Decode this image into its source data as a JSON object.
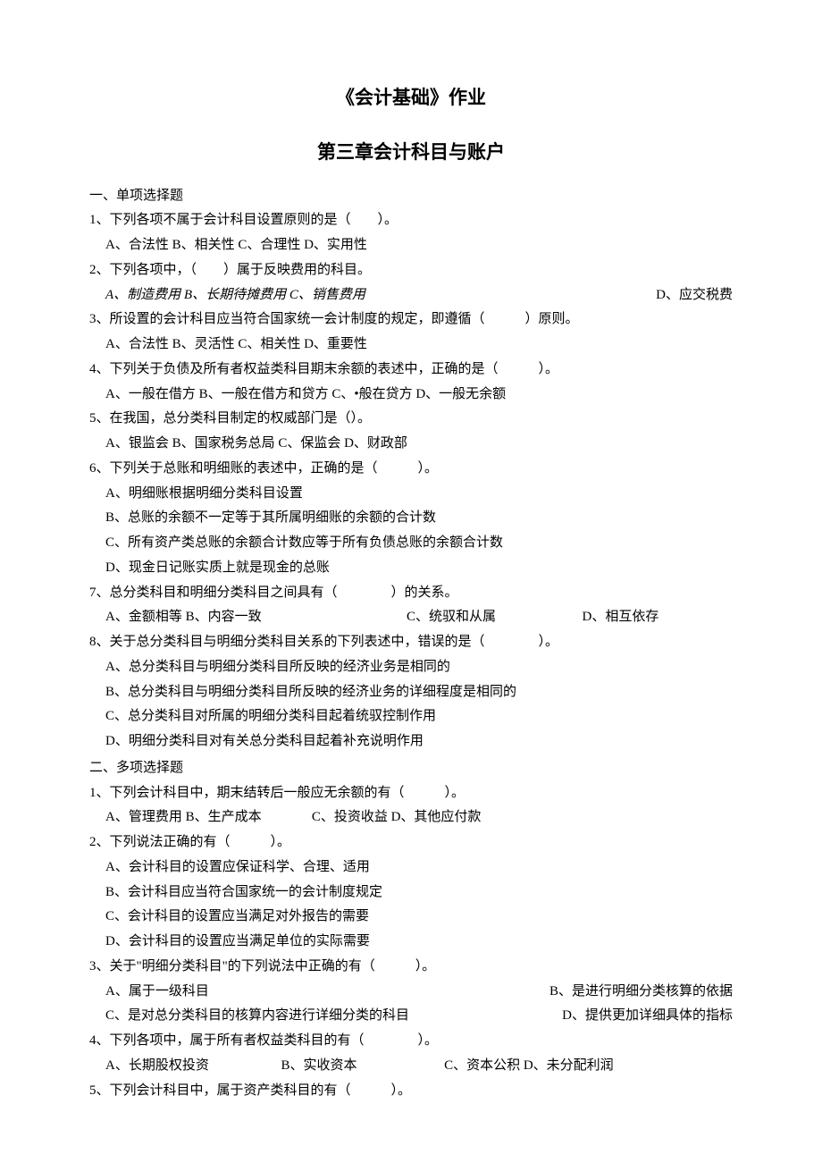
{
  "title_main": "《会计基础》作业",
  "title_sub": "第三章会计科目与账户",
  "section1": {
    "heading": "一、单项选择题",
    "q1": {
      "stem": "1、下列各项不属于会计科目设置原则的是（　　）。",
      "opts": "A、合法性 B、相关性 C、合理性 D、实用性"
    },
    "q2": {
      "stem": "2、下列各项中，（　　）属于反映费用的科目。",
      "opts_left": "A、制造费用 B、长期待摊费用 C、销售费用",
      "opts_right": "D、应交税费"
    },
    "q3": {
      "stem": "3、所设置的会计科目应当符合国家统一会计制度的规定，即遵循（　　　）原则。",
      "opts": "A、合法性 B、灵活性 C、相关性 D、重要性"
    },
    "q4": {
      "stem": "4、下列关于负债及所有者权益类科目期末余额的表述中，正确的是（　　　）。",
      "opts": "A、一般在借方 B、一般在借方和贷方 C、•般在贷方 D、一般无余额"
    },
    "q5": {
      "stem": "5、在我国，总分类科目制定的权威部门是（）。",
      "opts": "A、银监会 B、国家税务总局 C、保监会 D、财政部"
    },
    "q6": {
      "stem": "6、下列关于总账和明细账的表述中，正确的是（　　　）。",
      "a": "A、明细账根据明细分类科目设置",
      "b": "B、总账的余额不一定等于其所属明细账的余额的合计数",
      "c": "C、所有资产类总账的余额合计数应等于所有负债总账的余额合计数",
      "d": "D、现金日记账实质上就是现金的总账"
    },
    "q7": {
      "stem": "7、总分类科目和明细分类科目之间具有（　　　　）的关系。",
      "ab": "A、金额相等 B、内容一致",
      "c": "C、统驭和从属",
      "d": "D、相互依存"
    },
    "q8": {
      "stem": "8、关于总分类科目与明细分类科目关系的下列表述中，错误的是（　　　　）。",
      "a": "A、总分类科目与明细分类科目所反映的经济业务是相同的",
      "b": "B、总分类科目与明细分类科目所反映的经济业务的详细程度是相同的",
      "c": "C、总分类科目对所属的明细分类科目起着统驭控制作用",
      "d": "D、明细分类科目对有关总分类科目起着补充说明作用"
    }
  },
  "section2": {
    "heading": "二、多项选择题",
    "q1": {
      "stem": "1、下列会计科目中，期末结转后一般应无余额的有（　　　）。",
      "ab": "A、管理费用 B、生产成本",
      "cd": "C、投资收益 D、其他应付款"
    },
    "q2": {
      "stem": "2、下列说法正确的有（　　　）。",
      "a": "A、会计科目的设置应保证科学、合理、适用",
      "b": "B、会计科目应当符合国家统一的会计制度规定",
      "c": "C、会计科目的设置应当满足对外报告的需要",
      "d": "D、会计科目的设置应当满足单位的实际需要"
    },
    "q3": {
      "stem": "3、关于\"明细分类科目\"的下列说法中正确的有（　　　）。",
      "a": "A、属于一级科目",
      "b": "B、是进行明细分类核算的依据",
      "c": "C、是对总分类科目的核算内容进行详细分类的科目",
      "d": "D、提供更加详细具体的指标"
    },
    "q4": {
      "stem": "4、下列各项中，属于所有者权益类科目的有（　　　　）。",
      "a": "A、长期股权投资",
      "b": "B、实收资本",
      "cd": "C、资本公积 D、未分配利润"
    },
    "q5": {
      "stem": "5、下列会计科目中，属于资产类科目的有（　　　）。"
    }
  }
}
